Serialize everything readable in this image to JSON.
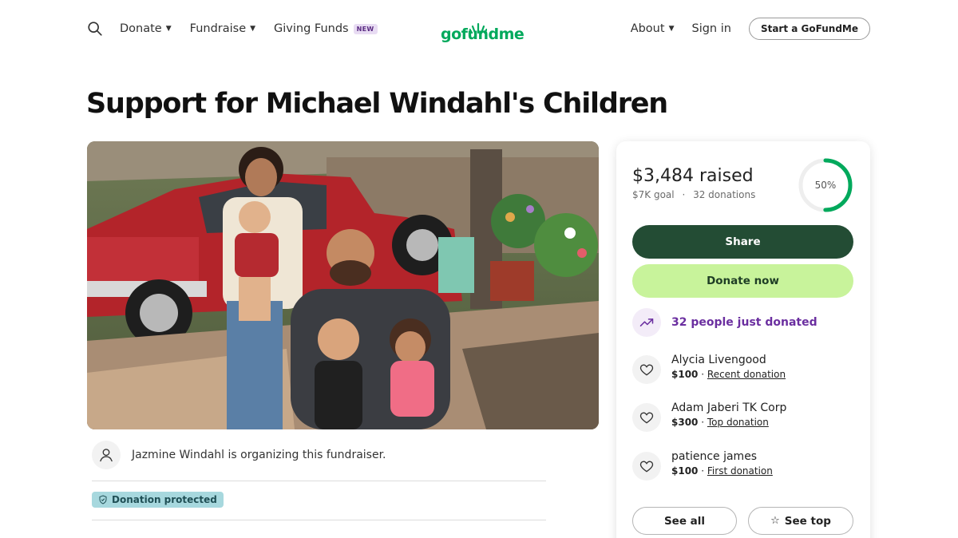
{
  "header": {
    "nav_left": [
      {
        "label": "Donate",
        "has_caret": true
      },
      {
        "label": "Fundraise",
        "has_caret": true
      },
      {
        "label": "Giving Funds",
        "badge": "NEW"
      }
    ],
    "logo_text": "gofundme",
    "nav_right": [
      {
        "label": "About",
        "has_caret": true
      },
      {
        "label": "Sign in"
      }
    ],
    "start_button": "Start a GoFundMe"
  },
  "campaign": {
    "title": "Support for Michael Windahl's Children",
    "organizer_text": "Jazmine Windahl is organizing this fundraiser.",
    "protected_label": "Donation protected"
  },
  "donation_card": {
    "raised": "$3,484 raised",
    "goal": "$7K goal",
    "separator": "·",
    "donation_count": "32 donations",
    "progress_percent": 50,
    "progress_label": "50%",
    "share_label": "Share",
    "donate_label": "Donate now",
    "just_donated": "32 people just donated",
    "donors": [
      {
        "name": "Alycia Livengood",
        "amount": "$100",
        "tag": "Recent donation"
      },
      {
        "name": "Adam Jaberi TK Corp",
        "amount": "$300",
        "tag": "Top donation"
      },
      {
        "name": "patience james",
        "amount": "$100",
        "tag": "First donation"
      }
    ],
    "see_all_label": "See all",
    "see_top_label": "See top"
  },
  "colors": {
    "brand_green": "#02a95c",
    "share_bg": "#234c34",
    "donate_bg": "#c8f39b",
    "accent_purple": "#6b2fa0",
    "protected_bg": "#a7d8de"
  }
}
